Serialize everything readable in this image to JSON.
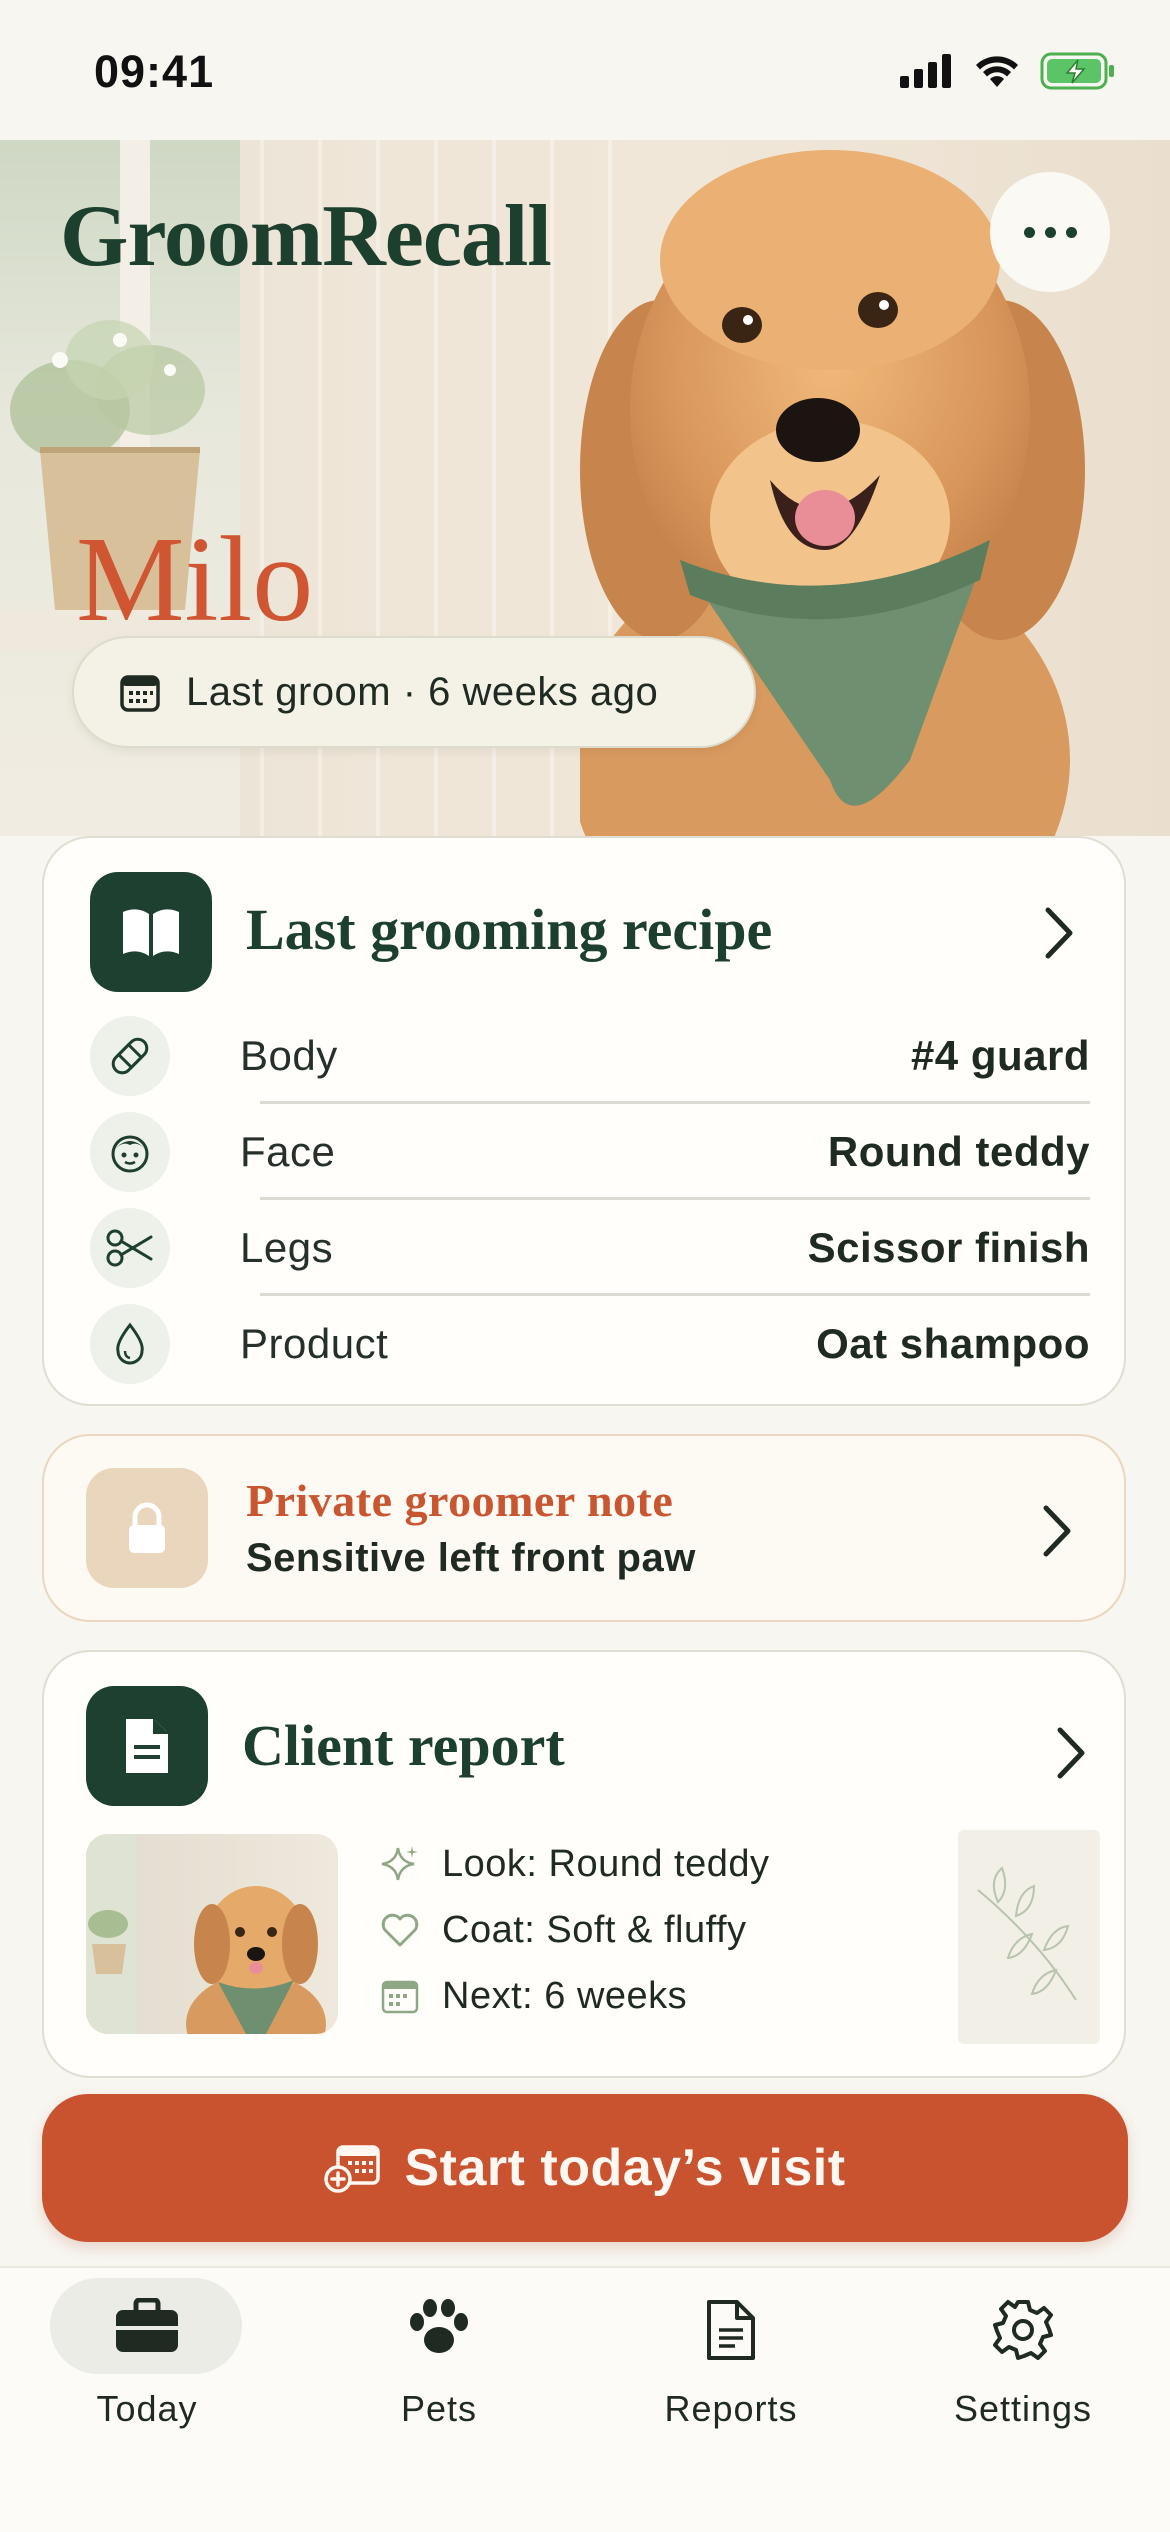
{
  "status_bar": {
    "time": "09:41"
  },
  "hero": {
    "brand": "GroomRecall",
    "pet_name": "Milo",
    "last_groom": "Last groom · 6 weeks ago",
    "more_icon": "more-horizontal-icon"
  },
  "recipe_card": {
    "title": "Last grooming recipe",
    "rows": [
      {
        "label": "Body",
        "value": "#4 guard",
        "icon": "bandage-icon"
      },
      {
        "label": "Face",
        "value": "Round teddy",
        "icon": "face-icon"
      },
      {
        "label": "Legs",
        "value": "Scissor finish",
        "icon": "scissors-icon"
      },
      {
        "label": "Product",
        "value": "Oat shampoo",
        "icon": "droplet-icon"
      }
    ]
  },
  "note_card": {
    "title": "Private groomer note",
    "body": "Sensitive left front paw"
  },
  "report_card": {
    "title": "Client report",
    "items": [
      {
        "text": "Look: Round teddy",
        "icon": "sparkle-icon"
      },
      {
        "text": "Coat: Soft & fluffy",
        "icon": "heart-icon"
      },
      {
        "text": "Next: 6 weeks",
        "icon": "calendar-icon"
      }
    ]
  },
  "cta": {
    "label": "Start today’s visit"
  },
  "tab_bar": {
    "tabs": [
      {
        "label": "Today",
        "icon": "briefcase-icon",
        "active": true
      },
      {
        "label": "Pets",
        "icon": "paw-icon",
        "active": false
      },
      {
        "label": "Reports",
        "icon": "document-icon",
        "active": false
      },
      {
        "label": "Settings",
        "icon": "gear-icon",
        "active": false
      }
    ]
  },
  "colors": {
    "brand_green": "#1d3f2e",
    "accent_orange": "#c9522f",
    "background": "#f8f6f1"
  }
}
